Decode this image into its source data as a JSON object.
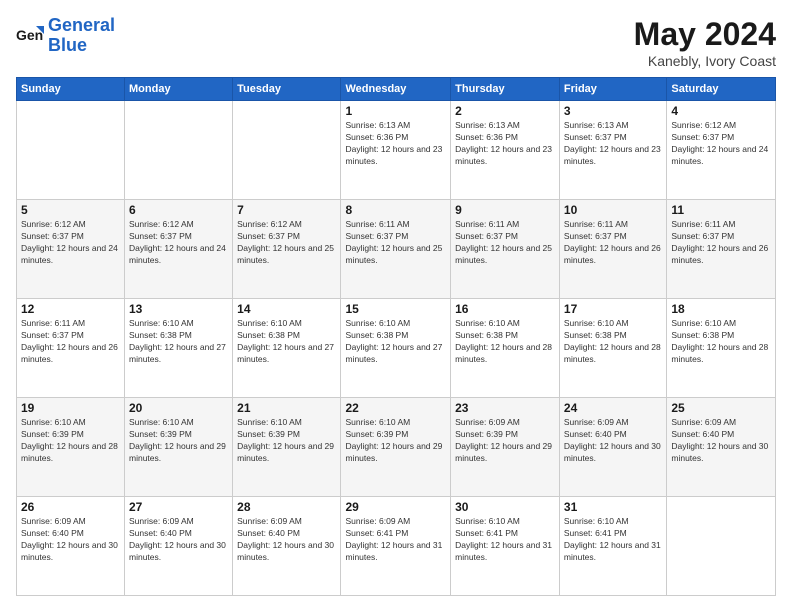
{
  "logo": {
    "line1": "General",
    "line2": "Blue"
  },
  "header": {
    "month": "May 2024",
    "location": "Kanebly, Ivory Coast"
  },
  "days_of_week": [
    "Sunday",
    "Monday",
    "Tuesday",
    "Wednesday",
    "Thursday",
    "Friday",
    "Saturday"
  ],
  "weeks": [
    [
      {
        "day": "",
        "sunrise": "",
        "sunset": "",
        "daylight": ""
      },
      {
        "day": "",
        "sunrise": "",
        "sunset": "",
        "daylight": ""
      },
      {
        "day": "",
        "sunrise": "",
        "sunset": "",
        "daylight": ""
      },
      {
        "day": "1",
        "sunrise": "Sunrise: 6:13 AM",
        "sunset": "Sunset: 6:36 PM",
        "daylight": "Daylight: 12 hours and 23 minutes."
      },
      {
        "day": "2",
        "sunrise": "Sunrise: 6:13 AM",
        "sunset": "Sunset: 6:36 PM",
        "daylight": "Daylight: 12 hours and 23 minutes."
      },
      {
        "day": "3",
        "sunrise": "Sunrise: 6:13 AM",
        "sunset": "Sunset: 6:37 PM",
        "daylight": "Daylight: 12 hours and 23 minutes."
      },
      {
        "day": "4",
        "sunrise": "Sunrise: 6:12 AM",
        "sunset": "Sunset: 6:37 PM",
        "daylight": "Daylight: 12 hours and 24 minutes."
      }
    ],
    [
      {
        "day": "5",
        "sunrise": "Sunrise: 6:12 AM",
        "sunset": "Sunset: 6:37 PM",
        "daylight": "Daylight: 12 hours and 24 minutes."
      },
      {
        "day": "6",
        "sunrise": "Sunrise: 6:12 AM",
        "sunset": "Sunset: 6:37 PM",
        "daylight": "Daylight: 12 hours and 24 minutes."
      },
      {
        "day": "7",
        "sunrise": "Sunrise: 6:12 AM",
        "sunset": "Sunset: 6:37 PM",
        "daylight": "Daylight: 12 hours and 25 minutes."
      },
      {
        "day": "8",
        "sunrise": "Sunrise: 6:11 AM",
        "sunset": "Sunset: 6:37 PM",
        "daylight": "Daylight: 12 hours and 25 minutes."
      },
      {
        "day": "9",
        "sunrise": "Sunrise: 6:11 AM",
        "sunset": "Sunset: 6:37 PM",
        "daylight": "Daylight: 12 hours and 25 minutes."
      },
      {
        "day": "10",
        "sunrise": "Sunrise: 6:11 AM",
        "sunset": "Sunset: 6:37 PM",
        "daylight": "Daylight: 12 hours and 26 minutes."
      },
      {
        "day": "11",
        "sunrise": "Sunrise: 6:11 AM",
        "sunset": "Sunset: 6:37 PM",
        "daylight": "Daylight: 12 hours and 26 minutes."
      }
    ],
    [
      {
        "day": "12",
        "sunrise": "Sunrise: 6:11 AM",
        "sunset": "Sunset: 6:37 PM",
        "daylight": "Daylight: 12 hours and 26 minutes."
      },
      {
        "day": "13",
        "sunrise": "Sunrise: 6:10 AM",
        "sunset": "Sunset: 6:38 PM",
        "daylight": "Daylight: 12 hours and 27 minutes."
      },
      {
        "day": "14",
        "sunrise": "Sunrise: 6:10 AM",
        "sunset": "Sunset: 6:38 PM",
        "daylight": "Daylight: 12 hours and 27 minutes."
      },
      {
        "day": "15",
        "sunrise": "Sunrise: 6:10 AM",
        "sunset": "Sunset: 6:38 PM",
        "daylight": "Daylight: 12 hours and 27 minutes."
      },
      {
        "day": "16",
        "sunrise": "Sunrise: 6:10 AM",
        "sunset": "Sunset: 6:38 PM",
        "daylight": "Daylight: 12 hours and 28 minutes."
      },
      {
        "day": "17",
        "sunrise": "Sunrise: 6:10 AM",
        "sunset": "Sunset: 6:38 PM",
        "daylight": "Daylight: 12 hours and 28 minutes."
      },
      {
        "day": "18",
        "sunrise": "Sunrise: 6:10 AM",
        "sunset": "Sunset: 6:38 PM",
        "daylight": "Daylight: 12 hours and 28 minutes."
      }
    ],
    [
      {
        "day": "19",
        "sunrise": "Sunrise: 6:10 AM",
        "sunset": "Sunset: 6:39 PM",
        "daylight": "Daylight: 12 hours and 28 minutes."
      },
      {
        "day": "20",
        "sunrise": "Sunrise: 6:10 AM",
        "sunset": "Sunset: 6:39 PM",
        "daylight": "Daylight: 12 hours and 29 minutes."
      },
      {
        "day": "21",
        "sunrise": "Sunrise: 6:10 AM",
        "sunset": "Sunset: 6:39 PM",
        "daylight": "Daylight: 12 hours and 29 minutes."
      },
      {
        "day": "22",
        "sunrise": "Sunrise: 6:10 AM",
        "sunset": "Sunset: 6:39 PM",
        "daylight": "Daylight: 12 hours and 29 minutes."
      },
      {
        "day": "23",
        "sunrise": "Sunrise: 6:09 AM",
        "sunset": "Sunset: 6:39 PM",
        "daylight": "Daylight: 12 hours and 29 minutes."
      },
      {
        "day": "24",
        "sunrise": "Sunrise: 6:09 AM",
        "sunset": "Sunset: 6:40 PM",
        "daylight": "Daylight: 12 hours and 30 minutes."
      },
      {
        "day": "25",
        "sunrise": "Sunrise: 6:09 AM",
        "sunset": "Sunset: 6:40 PM",
        "daylight": "Daylight: 12 hours and 30 minutes."
      }
    ],
    [
      {
        "day": "26",
        "sunrise": "Sunrise: 6:09 AM",
        "sunset": "Sunset: 6:40 PM",
        "daylight": "Daylight: 12 hours and 30 minutes."
      },
      {
        "day": "27",
        "sunrise": "Sunrise: 6:09 AM",
        "sunset": "Sunset: 6:40 PM",
        "daylight": "Daylight: 12 hours and 30 minutes."
      },
      {
        "day": "28",
        "sunrise": "Sunrise: 6:09 AM",
        "sunset": "Sunset: 6:40 PM",
        "daylight": "Daylight: 12 hours and 30 minutes."
      },
      {
        "day": "29",
        "sunrise": "Sunrise: 6:09 AM",
        "sunset": "Sunset: 6:41 PM",
        "daylight": "Daylight: 12 hours and 31 minutes."
      },
      {
        "day": "30",
        "sunrise": "Sunrise: 6:10 AM",
        "sunset": "Sunset: 6:41 PM",
        "daylight": "Daylight: 12 hours and 31 minutes."
      },
      {
        "day": "31",
        "sunrise": "Sunrise: 6:10 AM",
        "sunset": "Sunset: 6:41 PM",
        "daylight": "Daylight: 12 hours and 31 minutes."
      },
      {
        "day": "",
        "sunrise": "",
        "sunset": "",
        "daylight": ""
      }
    ]
  ]
}
